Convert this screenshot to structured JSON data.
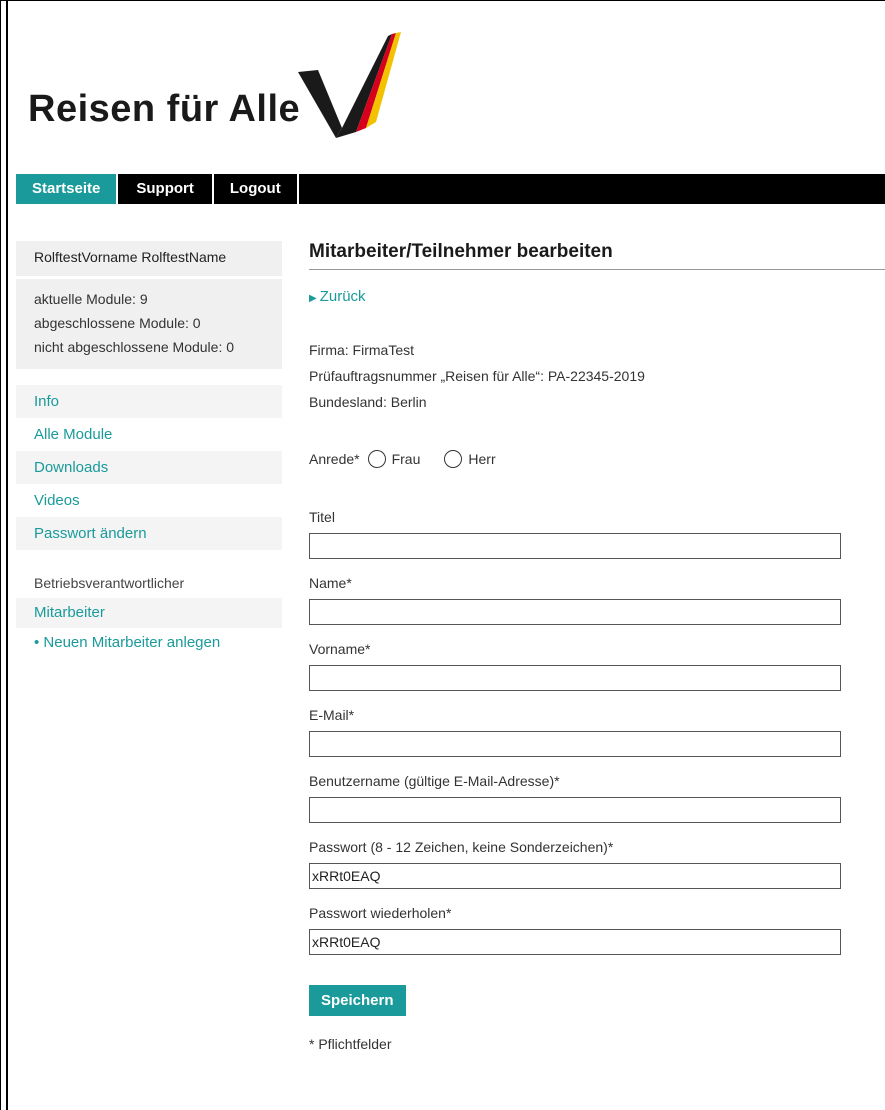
{
  "logo": {
    "text": "Reisen für Alle"
  },
  "topnav": {
    "tabs": [
      "Startseite",
      "Support",
      "Logout"
    ]
  },
  "sidebar": {
    "user_name": "RolftestVorname RolftestName",
    "stats": [
      "aktuelle Module: 9",
      "abgeschlossene Module: 0",
      "nicht abgeschlossene Module: 0"
    ],
    "nav": [
      "Info",
      "Alle Module",
      "Downloads",
      "Videos",
      "Passwort ändern"
    ],
    "section_heading": "Betriebsverantwortlicher",
    "section_item": "Mitarbeiter",
    "section_sub": "• Neuen Mitarbeiter anlegen"
  },
  "main": {
    "title": "Mitarbeiter/Teilnehmer bearbeiten",
    "back": "Zurück",
    "info": [
      "Firma: FirmaTest",
      "Prüfauftragsnummer „Reisen für Alle“: PA-22345-2019",
      "Bundesland: Berlin"
    ],
    "anrede_label": "Anrede*",
    "anrede_options": [
      "Frau",
      "Herr"
    ],
    "fields": [
      {
        "label": "Titel",
        "value": ""
      },
      {
        "label": "Name*",
        "value": ""
      },
      {
        "label": "Vorname*",
        "value": ""
      },
      {
        "label": "E-Mail*",
        "value": ""
      },
      {
        "label": "Benutzername (gültige E-Mail-Adresse)*",
        "value": ""
      },
      {
        "label": "Passwort (8 - 12 Zeichen, keine Sonderzeichen)*",
        "value": "xRRt0EAQ"
      },
      {
        "label": "Passwort wiederholen*",
        "value": "xRRt0EAQ"
      }
    ],
    "save_label": "Speichern",
    "required_note": "* Pflichtfelder"
  },
  "colors": {
    "accent": "#1a9a9a",
    "nav_bg": "#000000"
  }
}
